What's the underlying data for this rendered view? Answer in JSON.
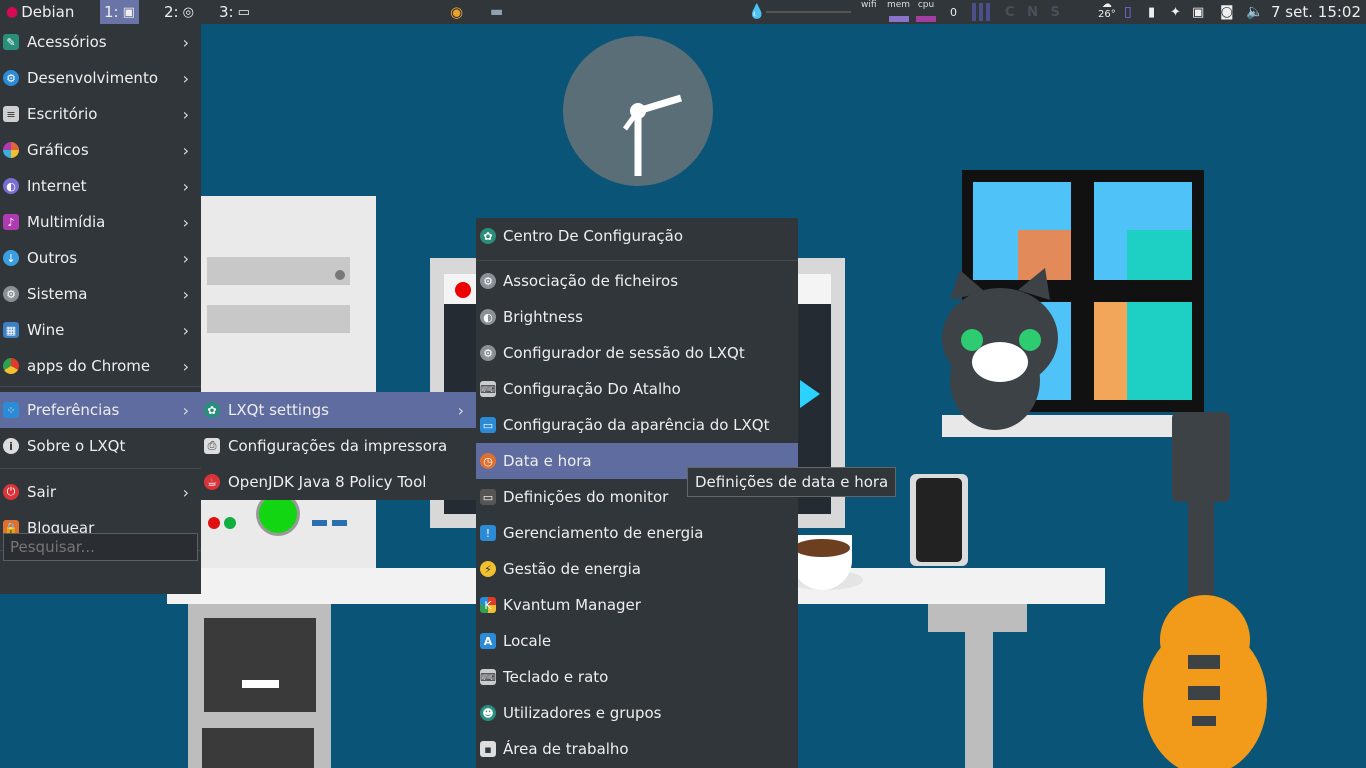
{
  "panel": {
    "start_label": "Debian",
    "workspaces": [
      {
        "label": "1:",
        "active": true
      },
      {
        "label": "2:",
        "active": false
      },
      {
        "label": "3:",
        "active": false
      }
    ],
    "monitors": {
      "wifi": "wifi",
      "mem": "mem",
      "cpu": "cpu"
    },
    "counter": "0",
    "keyboard_indicators": "C N S",
    "weather_temp": "26°",
    "clock": "7 set. 15:02"
  },
  "menu": {
    "items": [
      {
        "label": "Acessórios",
        "icon": "accessories-icon",
        "color": "#2a8f7a"
      },
      {
        "label": "Desenvolvimento",
        "icon": "development-icon",
        "color": "#2b8bd6"
      },
      {
        "label": "Escritório",
        "icon": "office-icon",
        "color": "#cfcfcf"
      },
      {
        "label": "Gráficos",
        "icon": "graphics-icon",
        "color": "#e0663a"
      },
      {
        "label": "Internet",
        "icon": "internet-icon",
        "color": "#7a6fd0"
      },
      {
        "label": "Multimídia",
        "icon": "multimedia-icon",
        "color": "#b03bb0"
      },
      {
        "label": "Outros",
        "icon": "others-icon",
        "color": "#3a9ee0"
      },
      {
        "label": "Sistema",
        "icon": "system-icon",
        "color": "#8a9096"
      },
      {
        "label": "Wine",
        "icon": "wine-icon",
        "color": "#3d7fc4"
      },
      {
        "label": "apps do Chrome",
        "icon": "chrome-icon",
        "color": "#e0a82a"
      }
    ],
    "preferences_label": "Preferências",
    "about_label": "Sobre o LXQt",
    "logout_label": "Sair",
    "lock_label": "Bloquear",
    "search_placeholder": "Pesquisar..."
  },
  "submenu1": {
    "items": [
      {
        "label": "LXQt settings",
        "icon": "lxqt-settings-icon",
        "has_arrow": true
      },
      {
        "label": "Configurações da impressora",
        "icon": "printer-icon",
        "has_arrow": false
      },
      {
        "label": "OpenJDK Java 8 Policy Tool",
        "icon": "java-icon",
        "has_arrow": false
      }
    ]
  },
  "submenu2": {
    "header": "Centro De Configuração",
    "items": [
      {
        "label": "Associação de ficheiros",
        "icon": "gear-icon"
      },
      {
        "label": "Brightness",
        "icon": "brightness-icon"
      },
      {
        "label": "Configurador de sessão do LXQt",
        "icon": "session-icon"
      },
      {
        "label": "Configuração Do Atalho",
        "icon": "keyboard-shortcut-icon"
      },
      {
        "label": "Configuração da aparência do LXQt",
        "icon": "appearance-icon"
      },
      {
        "label": "Data e hora",
        "icon": "clock-icon",
        "highlighted": true
      },
      {
        "label": "Definições do monitor",
        "icon": "monitor-icon"
      },
      {
        "label": "Gerenciamento de energia",
        "icon": "energy-management-icon"
      },
      {
        "label": "Gestão de energia",
        "icon": "power-icon"
      },
      {
        "label": "Kvantum Manager",
        "icon": "kvantum-icon"
      },
      {
        "label": "Locale",
        "icon": "locale-icon"
      },
      {
        "label": "Teclado e rato",
        "icon": "keyboard-icon"
      },
      {
        "label": "Utilizadores e grupos",
        "icon": "users-icon"
      },
      {
        "label": "Área de trabalho",
        "icon": "desktop-icon"
      }
    ]
  },
  "tooltip": {
    "text": "Definições de data e hora"
  }
}
